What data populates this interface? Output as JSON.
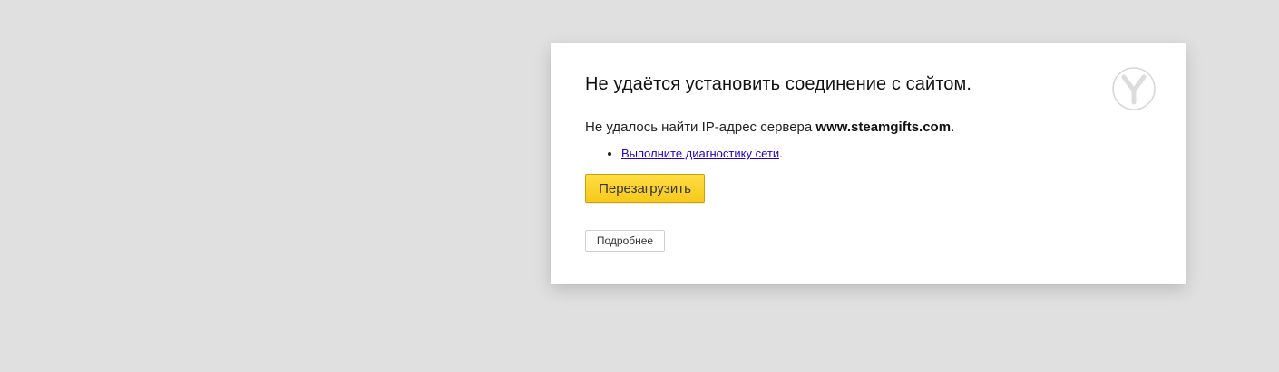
{
  "error_card": {
    "title": "Не удаётся установить соединение с сайтом.",
    "message_prefix": "Не удалось найти IP-адрес сервера ",
    "host": "www.steamgifts.com",
    "message_suffix": ".",
    "suggestions": [
      {
        "link_text": "Выполните диагностику сети",
        "trailing": "."
      }
    ],
    "reload_label": "Перезагрузить",
    "details_label": "Подробнее",
    "logo_icon": "yandex-browser-logo-icon"
  },
  "colors": {
    "background": "#e0e0e0",
    "card": "#ffffff",
    "reload_button": "#f7c91a",
    "link": "#2200cc"
  }
}
